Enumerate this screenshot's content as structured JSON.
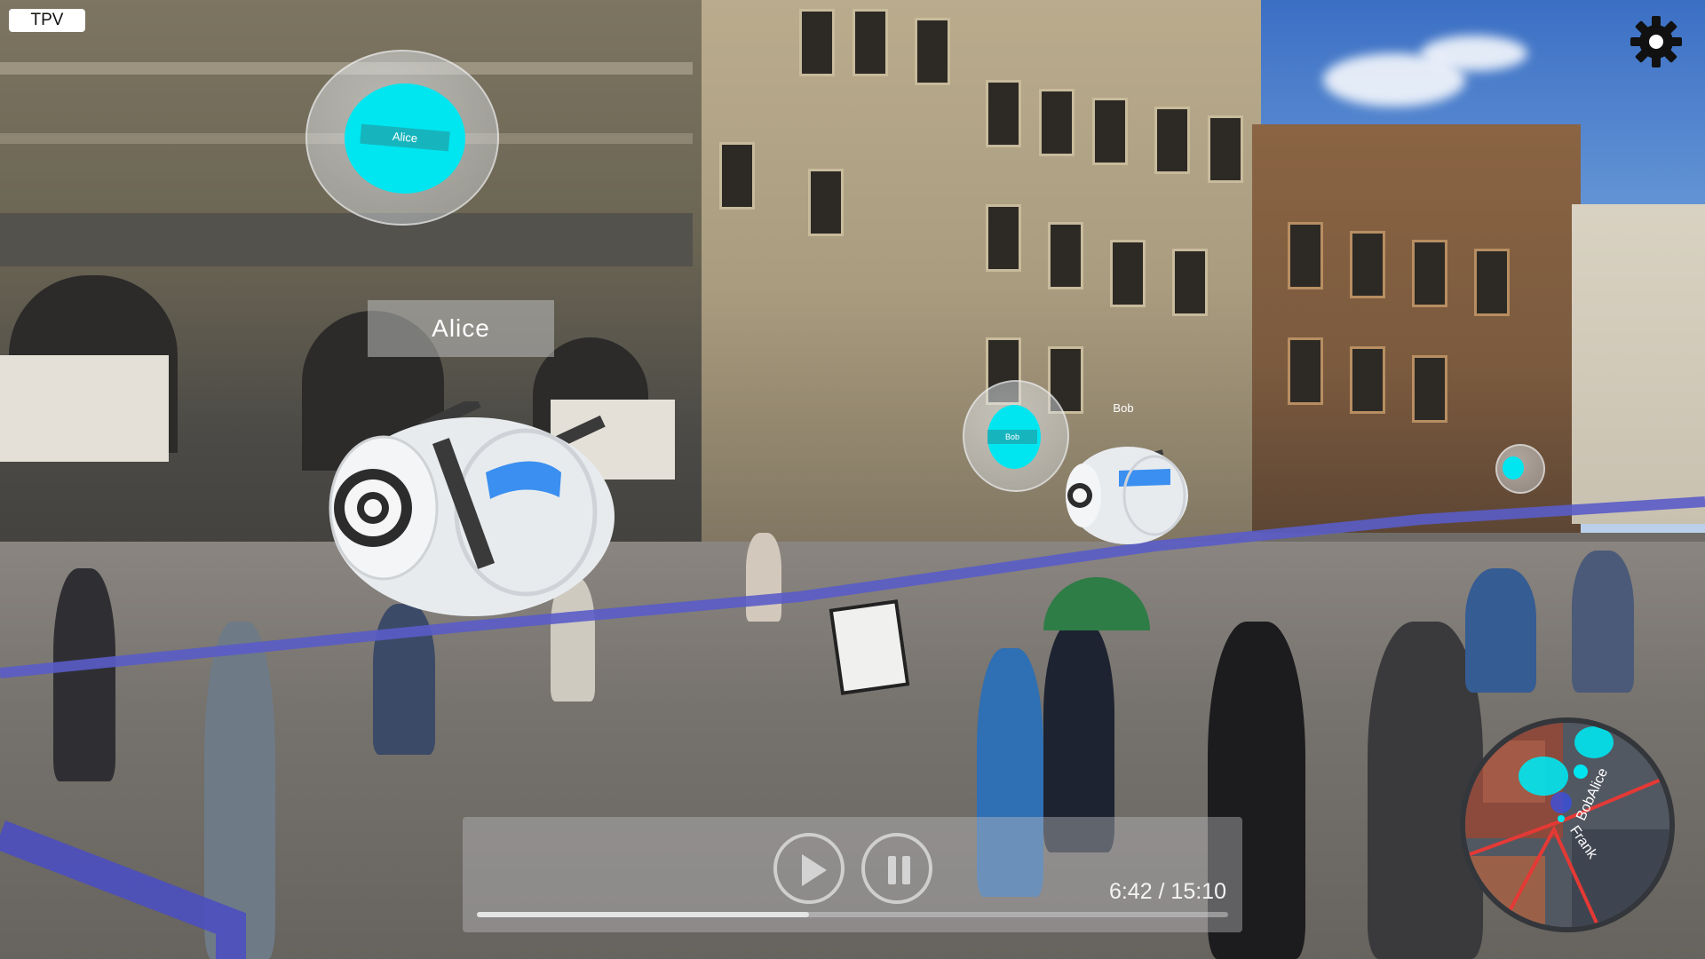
{
  "view_mode_label": "TPV",
  "settings": {
    "icon": "gear-icon"
  },
  "avatars": [
    {
      "name": "Alice",
      "bubble_label": "Alice"
    },
    {
      "name": "Bob",
      "bubble_label": "Bob"
    }
  ],
  "name_labels": {
    "alice": "Alice",
    "bob": "Bob"
  },
  "player": {
    "play_icon": "play-icon",
    "pause_icon": "pause-icon",
    "time": "6:42 / 15:10",
    "progress": 0.442
  },
  "minimap": {
    "labels": {
      "bob_alice": "BobAlice",
      "frank": "Frank"
    }
  },
  "colors": {
    "accent_cyan": "#00e6f0",
    "path_line": "#5a5cc8",
    "robot_visor": "#3a8ff0"
  }
}
